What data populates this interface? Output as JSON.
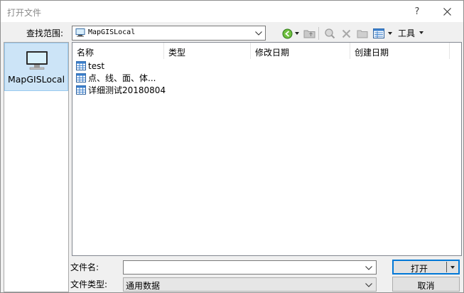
{
  "window": {
    "title": "打开文件"
  },
  "titlebar": {
    "help": "?",
    "close_icon": "close-icon"
  },
  "lookin": {
    "label": "查找范围:",
    "value": "MapGISLocal",
    "icon": "computer-icon"
  },
  "toolbar": {
    "icons": [
      "back-icon",
      "up-folder-icon",
      "search-web-icon",
      "delete-icon",
      "new-folder-icon",
      "view-menu-icon"
    ],
    "tools_label": "工具"
  },
  "places": {
    "items": [
      {
        "label": "MapGISLocal",
        "icon": "computer-icon",
        "selected": true
      }
    ]
  },
  "filelist": {
    "columns": [
      "名称",
      "类型",
      "修改日期",
      "创建日期"
    ],
    "items": [
      {
        "name": "test",
        "icon": "database-icon"
      },
      {
        "name": "点、线、面、体...",
        "icon": "database-icon"
      },
      {
        "name": "详细测试20180804",
        "icon": "database-icon"
      }
    ]
  },
  "filename": {
    "label": "文件名:",
    "value": ""
  },
  "filetype": {
    "label": "文件类型:",
    "value": "通用数据"
  },
  "buttons": {
    "open": "打开",
    "cancel": "取消"
  },
  "colors": {
    "accent": "#0078d7",
    "selection": "#cce4f7"
  }
}
